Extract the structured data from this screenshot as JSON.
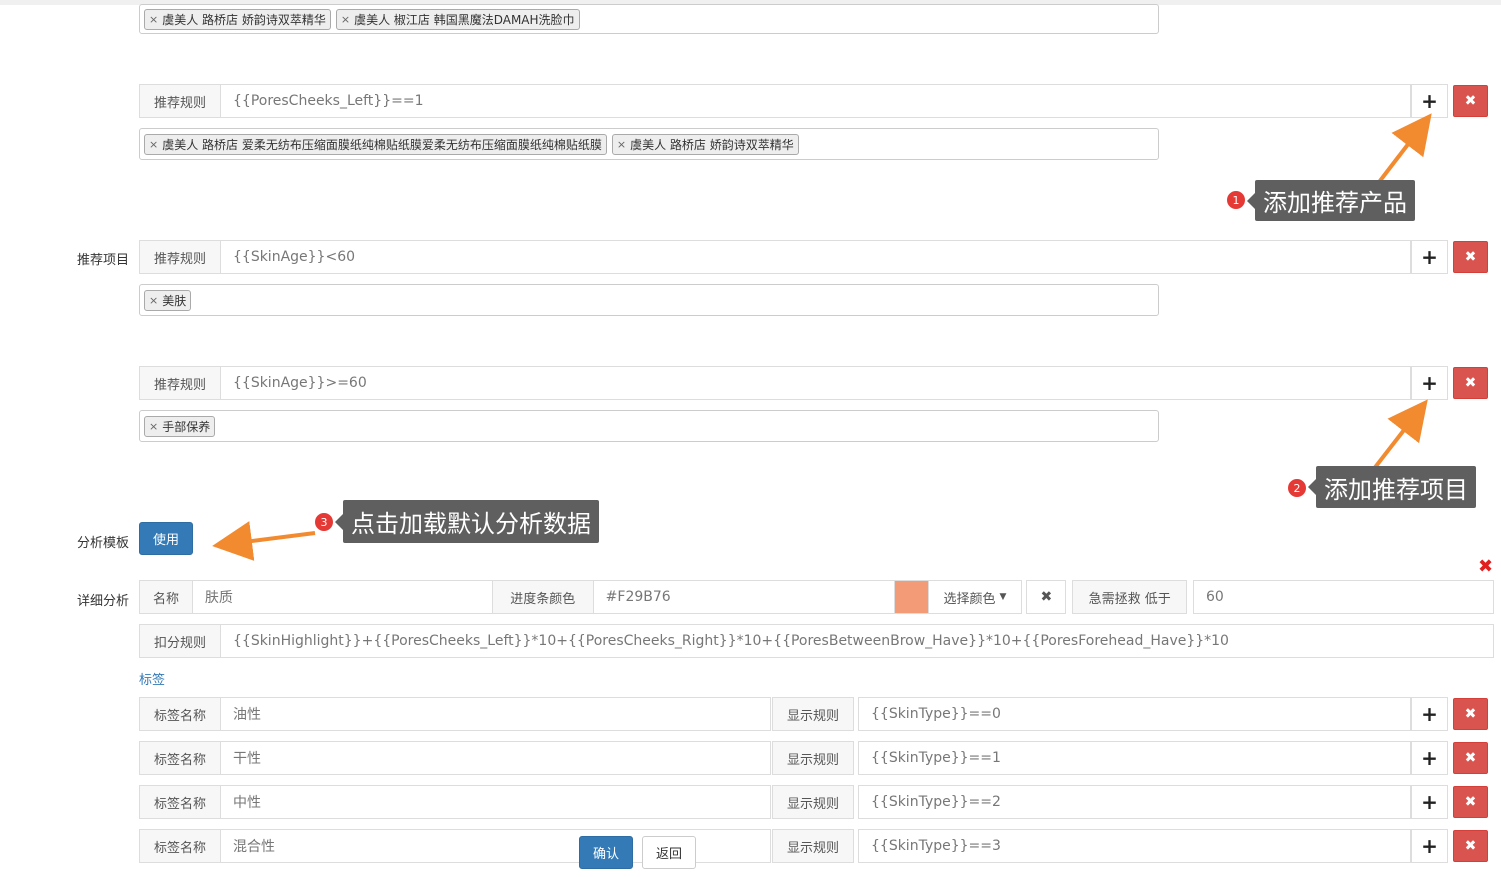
{
  "recommend_section": {
    "row0": {
      "tags": [
        "虞美人 路桥店 娇韵诗双萃精华",
        "虞美人 椒江店 韩国黑魔法DAMAH洗脸巾"
      ]
    },
    "row1": {
      "label": "推荐规则",
      "value": "{{PoresCheeks_Left}}==1",
      "tags": [
        "虞美人 路桥店 爱柔无纺布压缩面膜纸纯棉贴纸膜爱柔无纺布压缩面膜纸纯棉贴纸膜",
        "虞美人 路桥店 娇韵诗双萃精华"
      ]
    },
    "project_label": "推荐项目",
    "row2": {
      "label": "推荐规则",
      "value": "{{SkinAge}}<60",
      "tags": [
        "美肤"
      ]
    },
    "row3": {
      "label": "推荐规则",
      "value": "{{SkinAge}}>=60",
      "tags": [
        "手部保养"
      ]
    },
    "plus_icon": "plus-icon",
    "delete_icon": "times-icon"
  },
  "callouts": {
    "c1": {
      "num": "1",
      "text": "添加推荐产品"
    },
    "c2": {
      "num": "2",
      "text": "添加推荐项目"
    },
    "c3": {
      "num": "3",
      "text": "点击加载默认分析数据"
    },
    "arrow_color": "#F28A30"
  },
  "template": {
    "label": "分析模板",
    "use_button": "使用"
  },
  "detail": {
    "label": "详细分析",
    "name_label": "名称",
    "name_value": "肤质",
    "color_label": "进度条颜色",
    "color_value": "#F29B76",
    "color_swatch": "#F29B76",
    "choose_color": "选择颜色",
    "urgent_label": "急需拯救 低于",
    "urgent_value": "60",
    "deduct_label": "扣分规则",
    "deduct_value": "{{SkinHighlight}}+{{PoresCheeks_Left}}*10+{{PoresCheeks_Right}}*10+{{PoresBetweenBrow_Have}}*10+{{PoresForehead_Have}}*10",
    "tags_title": "标签",
    "tag_name_label": "标签名称",
    "show_rule_label": "显示规则",
    "tags": [
      {
        "name": "油性",
        "rule": "{{SkinType}}==0"
      },
      {
        "name": "干性",
        "rule": "{{SkinType}}==1"
      },
      {
        "name": "中性",
        "rule": "{{SkinType}}==2"
      },
      {
        "name": "混合性",
        "rule": "{{SkinType}}==3"
      }
    ]
  },
  "footer": {
    "confirm": "确认",
    "back": "返回"
  }
}
